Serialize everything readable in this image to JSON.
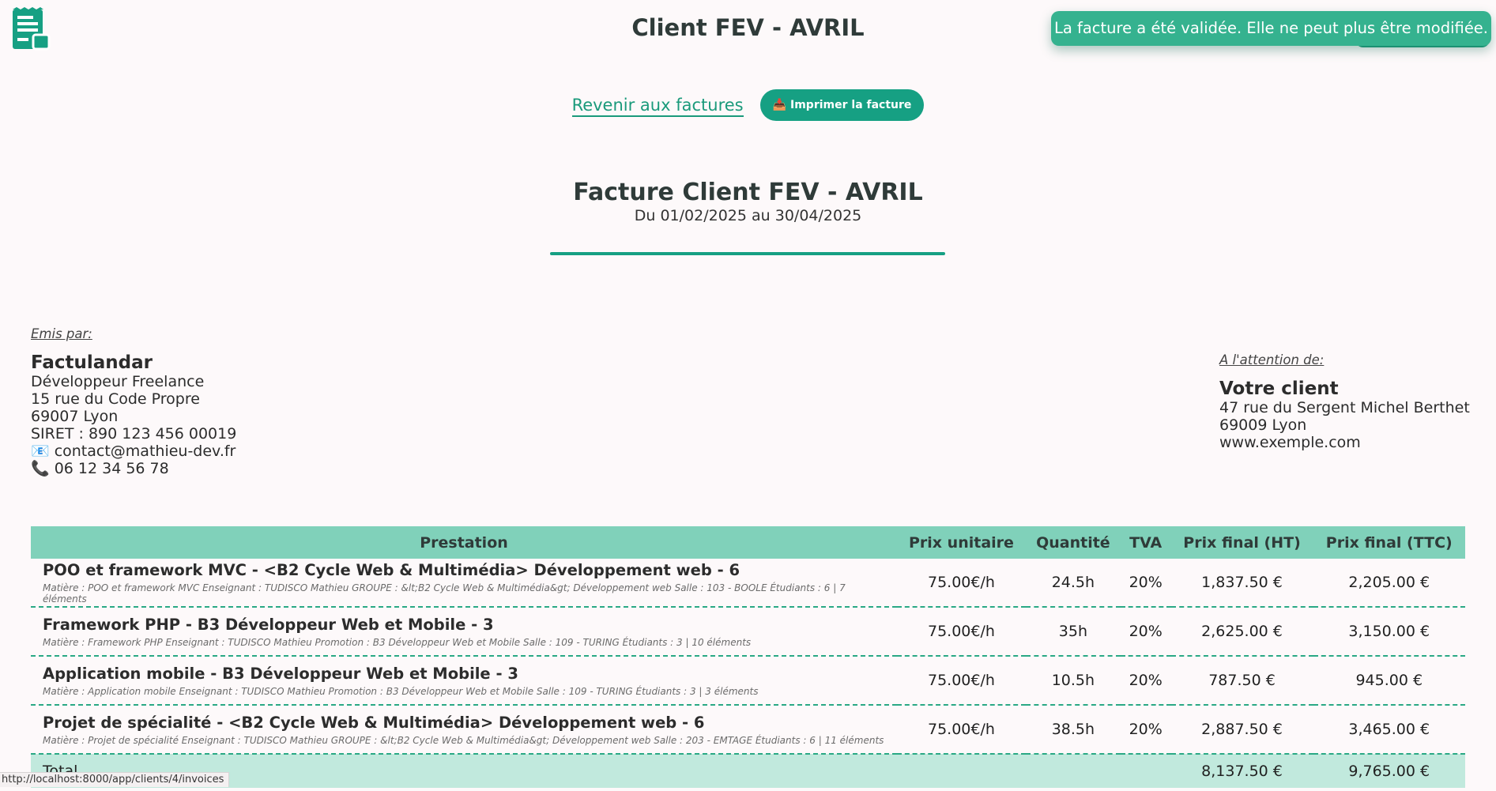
{
  "header": {
    "logo_icon": "invoice-receipt-icon",
    "title": "Client FEV - AVRIL"
  },
  "toast": {
    "message": "La facture a été validée. Elle ne peut plus être modifiée."
  },
  "actions": {
    "back_label": "Revenir aux factures",
    "print_label": "📥 Imprimer la facture"
  },
  "invoice": {
    "title": "Facture Client FEV - AVRIL",
    "period": "Du 01/02/2025 au 30/04/2025"
  },
  "issuer": {
    "section_label": "Emis par:",
    "name": "Factulandar",
    "role": "Développeur Freelance",
    "street": "15 rue du Code Propre",
    "city": "69007 Lyon",
    "siret": "SIRET : 890 123 456 00019",
    "email": "📧 contact@mathieu-dev.fr",
    "phone": "📞 06 12 34 56 78"
  },
  "recipient": {
    "section_label": "A l'attention de:",
    "name": "Votre client",
    "street": "47 rue du Sergent Michel Berthet",
    "city": "69009 Lyon",
    "website": "www.exemple.com"
  },
  "table": {
    "headers": {
      "prestation": "Prestation",
      "unit_price": "Prix unitaire",
      "quantity": "Quantité",
      "vat": "TVA",
      "total_ht": "Prix final (HT)",
      "total_ttc": "Prix final (TTC)"
    },
    "rows": [
      {
        "title": "POO et framework MVC - <B2 Cycle Web & Multimédia> Développement web - 6",
        "details": "Matière : POO et framework MVC Enseignant : TUDISCO Mathieu GROUPE : &lt;B2 Cycle Web & Multimédia&gt; Développement web Salle : 103 - BOOLE Étudiants : 6 | 7 éléments",
        "unit_price": "75.00€/h",
        "quantity": "24.5h",
        "vat": "20%",
        "total_ht": "1,837.50 €",
        "total_ttc": "2,205.00 €"
      },
      {
        "title": "Framework PHP - B3 Développeur Web et Mobile - 3",
        "details": "Matière : Framework PHP Enseignant : TUDISCO Mathieu Promotion : B3 Développeur Web et Mobile Salle : 109 - TURING Étudiants : 3 | 10 éléments",
        "unit_price": "75.00€/h",
        "quantity": "35h",
        "vat": "20%",
        "total_ht": "2,625.00 €",
        "total_ttc": "3,150.00 €"
      },
      {
        "title": "Application mobile - B3 Développeur Web et Mobile - 3",
        "details": "Matière : Application mobile Enseignant : TUDISCO Mathieu Promotion : B3 Développeur Web et Mobile Salle : 109 - TURING Étudiants : 3 | 3 éléments",
        "unit_price": "75.00€/h",
        "quantity": "10.5h",
        "vat": "20%",
        "total_ht": "787.50 €",
        "total_ttc": "945.00 €"
      },
      {
        "title": "Projet de spécialité - <B2 Cycle Web & Multimédia> Développement web - 6",
        "details": "Matière : Projet de spécialité Enseignant : TUDISCO Mathieu GROUPE : &lt;B2 Cycle Web & Multimédia&gt; Développement web Salle : 203 - EMTAGE Étudiants : 6 | 11 éléments",
        "unit_price": "75.00€/h",
        "quantity": "38.5h",
        "vat": "20%",
        "total_ht": "2,887.50 €",
        "total_ttc": "3,465.00 €"
      }
    ],
    "total": {
      "label": "Total",
      "total_ht": "8,137.50 €",
      "total_ttc": "9,765.00 €"
    }
  },
  "status_bar": {
    "url": "http://localhost:8000/app/clients/4/invoices"
  },
  "colors": {
    "accent": "#16a083",
    "header_row": "#80d1ba",
    "total_row": "#c1e9dd",
    "toast": "#35b28f"
  }
}
